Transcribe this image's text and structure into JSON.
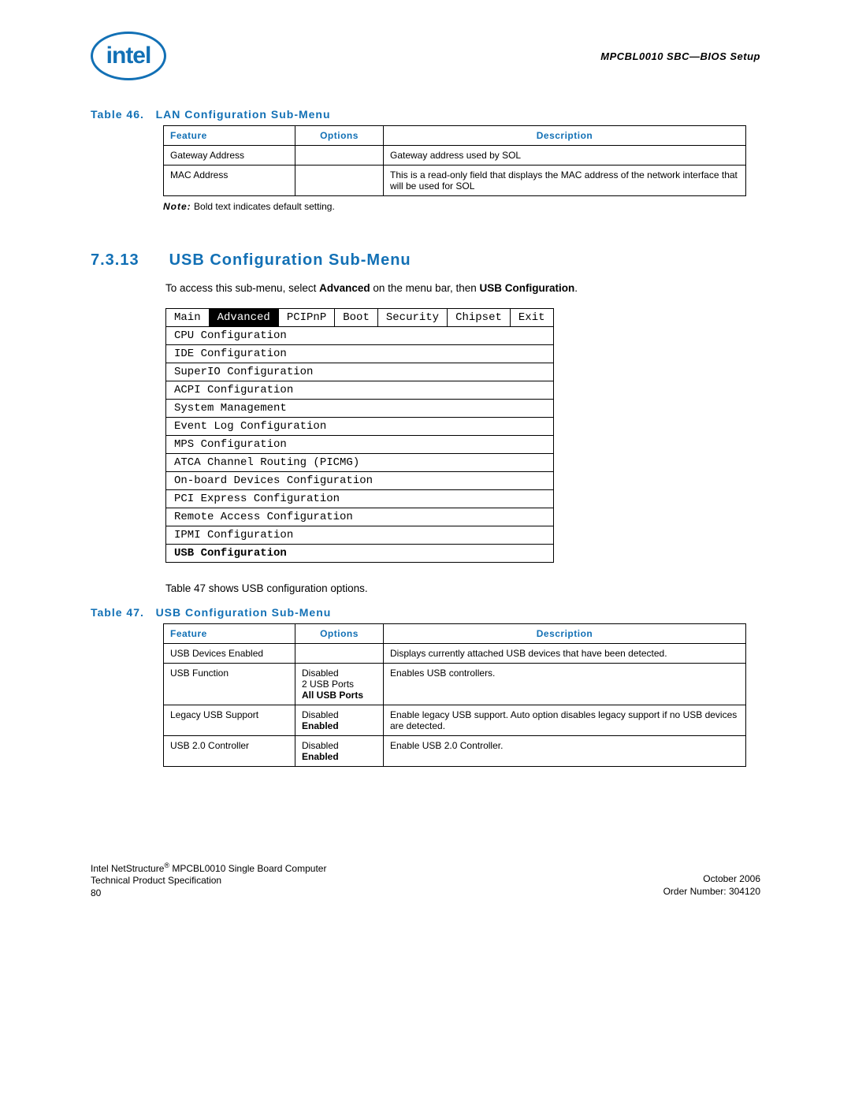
{
  "header": {
    "logo_text": "intel",
    "doc_label": "MPCBL0010 SBC—BIOS Setup"
  },
  "table46": {
    "caption_num": "Table 46.",
    "caption_title": "LAN Configuration Sub-Menu",
    "cols": {
      "feature": "Feature",
      "options": "Options",
      "description": "Description"
    },
    "rows": [
      {
        "feature": "Gateway Address",
        "options": "",
        "description": "Gateway address used by SOL"
      },
      {
        "feature": "MAC Address",
        "options": "",
        "description": "This is a read-only field that displays the MAC address of the network interface that will be used for SOL"
      }
    ]
  },
  "note": {
    "label": "Note:",
    "text": "Bold text indicates default setting."
  },
  "section": {
    "num": "7.3.13",
    "title": "USB Configuration Sub-Menu",
    "intro_pre": "To access this sub-menu, select ",
    "intro_adv": "Advanced",
    "intro_mid": " on the menu bar, then ",
    "intro_usb": "USB Configuration",
    "intro_post": "."
  },
  "bios": {
    "tabs": [
      "Main",
      "Advanced",
      "PCIPnP",
      "Boot",
      "Security",
      "Chipset",
      "Exit"
    ],
    "items": [
      "CPU Configuration",
      "IDE Configuration",
      "SuperIO Configuration",
      "ACPI Configuration",
      "System Management",
      "Event Log Configuration",
      "MPS Configuration",
      "ATCA Channel Routing (PICMG)",
      "On-board Devices Configuration",
      "PCI Express Configuration",
      "Remote Access Configuration",
      "IPMI Configuration",
      "USB Configuration"
    ],
    "bold_item_index": 12
  },
  "para2": "Table 47 shows USB configuration options.",
  "table47": {
    "caption_num": "Table 47.",
    "caption_title": "USB Configuration Sub-Menu",
    "cols": {
      "feature": "Feature",
      "options": "Options",
      "description": "Description"
    },
    "rows": [
      {
        "feature": "USB Devices Enabled",
        "options": [],
        "description": "Displays currently attached USB devices that have been detected."
      },
      {
        "feature": "USB Function",
        "options": [
          "Disabled",
          "2 USB Ports",
          "All USB Ports"
        ],
        "bold": [
          false,
          false,
          true
        ],
        "description": "Enables USB controllers."
      },
      {
        "feature": "Legacy USB Support",
        "options": [
          "Disabled",
          "Enabled"
        ],
        "bold": [
          false,
          true
        ],
        "description": "Enable legacy USB support. Auto option disables legacy support if no USB devices are detected."
      },
      {
        "feature": "USB 2.0 Controller",
        "options": [
          "Disabled",
          "Enabled"
        ],
        "bold": [
          false,
          true
        ],
        "description": "Enable USB 2.0 Controller."
      }
    ]
  },
  "footer": {
    "l1": "Intel NetStructure",
    "l1b": " MPCBL0010 Single Board Computer",
    "l2": "Technical Product Specification",
    "l3": "80",
    "r1": "October 2006",
    "r2": "Order Number: 304120"
  }
}
